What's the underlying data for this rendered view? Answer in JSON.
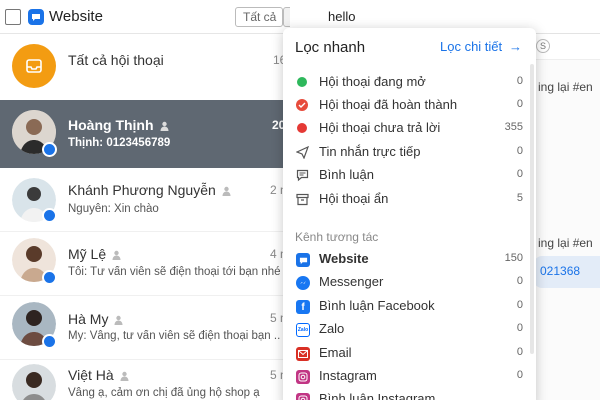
{
  "header": {
    "channel_title": "Website",
    "filter_select_value": "Tất cả",
    "search_value": "hello"
  },
  "conversations": {
    "all": {
      "label": "Tất cả hội thoại",
      "count": "16"
    },
    "items": [
      {
        "name": "Hoàng Thịnh",
        "preview": "Thịnh: 0123456789",
        "time": "20",
        "active": true
      },
      {
        "name": "Khánh Phương Nguyễn",
        "preview": "Nguyễn: Xin chào",
        "time": "2 n",
        "active": false
      },
      {
        "name": "Mỹ Lệ",
        "preview": "Tôi: Tư vấn viên sẽ điện thoại tới bạn nhé",
        "time": "4 n",
        "active": false
      },
      {
        "name": "Hà My",
        "preview": "My: Vâng, tư vấn viên sẽ điện thoại bạn ...",
        "time": "5 n",
        "active": false
      },
      {
        "name": "Việt Hà",
        "preview": "Vâng ạ, cảm ơn chị đã ủng hộ shop ạ",
        "time": "5 n",
        "active": false
      }
    ]
  },
  "right_fragments": {
    "frag1": "ing lại #en",
    "frag2": "ing lại #en",
    "frag3": "021368",
    "circle_s": "S"
  },
  "quick_filter": {
    "title": "Lọc nhanh",
    "detail_link": "Lọc chi tiết",
    "detail_arrow": "→",
    "items": [
      {
        "label": "Hội thoại đang mở",
        "count": "0",
        "icon": "green-dot-icon",
        "color": "#2eb85c"
      },
      {
        "label": "Hội thoại đã hoàn thành",
        "count": "0",
        "icon": "red-check-circle-icon",
        "color": "#e74c3c"
      },
      {
        "label": "Hội thoại chưa trả lời",
        "count": "355",
        "icon": "red-dot-icon",
        "color": "#e53935"
      },
      {
        "label": "Tin nhắn trực tiếp",
        "count": "0",
        "icon": "send-icon",
        "color": "#555555"
      },
      {
        "label": "Bình luận",
        "count": "0",
        "icon": "comment-icon",
        "color": "#555555"
      },
      {
        "label": "Hội thoại ẩn",
        "count": "5",
        "icon": "archive-icon",
        "color": "#555555"
      }
    ],
    "channels_section": "Kênh tương tác",
    "channels": [
      {
        "label": "Website",
        "count": "150",
        "icon": "website-icon",
        "color": "#1a73e8",
        "bold": true
      },
      {
        "label": "Messenger",
        "count": "0",
        "icon": "messenger-icon",
        "color": "#1877f2",
        "bold": false
      },
      {
        "label": "Bình luận Facebook",
        "count": "0",
        "icon": "facebook-icon",
        "color": "#1877f2",
        "bold": false
      },
      {
        "label": "Zalo",
        "count": "0",
        "icon": "zalo-icon",
        "color": "#0068ff",
        "bold": false
      },
      {
        "label": "Email",
        "count": "0",
        "icon": "email-icon",
        "color": "#d93025",
        "bold": false
      },
      {
        "label": "Instagram",
        "count": "0",
        "icon": "instagram-icon",
        "color": "#c13584",
        "bold": false
      },
      {
        "label": "Bình luận Instagram",
        "count": "",
        "icon": "instagram-icon",
        "color": "#c13584",
        "bold": false
      }
    ]
  }
}
